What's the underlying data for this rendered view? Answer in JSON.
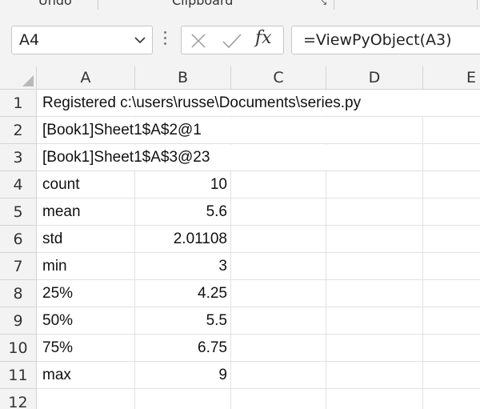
{
  "ribbon": {
    "groups": [
      "Undo",
      "Clipboard"
    ]
  },
  "name_box": {
    "value": "A4"
  },
  "formula_bar": {
    "fx_label": "fx",
    "formula": "=ViewPyObject(A3)"
  },
  "columns": [
    "A",
    "B",
    "C",
    "D",
    "E"
  ],
  "rows": [
    {
      "num": "1",
      "a": "Registered c:\\users\\russe\\Documents\\series.py",
      "b": ""
    },
    {
      "num": "2",
      "a": "[Book1]Sheet1$A$2@1",
      "b": ""
    },
    {
      "num": "3",
      "a": "[Book1]Sheet1$A$3@23",
      "b": ""
    },
    {
      "num": "4",
      "a": "count",
      "b": "10"
    },
    {
      "num": "5",
      "a": "mean",
      "b": "5.6"
    },
    {
      "num": "6",
      "a": "std",
      "b": "2.01108"
    },
    {
      "num": "7",
      "a": "min",
      "b": "3"
    },
    {
      "num": "8",
      "a": "25%",
      "b": "4.25"
    },
    {
      "num": "9",
      "a": "50%",
      "b": "5.5"
    },
    {
      "num": "10",
      "a": "75%",
      "b": "6.75"
    },
    {
      "num": "11",
      "a": "max",
      "b": "9"
    },
    {
      "num": "12",
      "a": "",
      "b": ""
    }
  ]
}
